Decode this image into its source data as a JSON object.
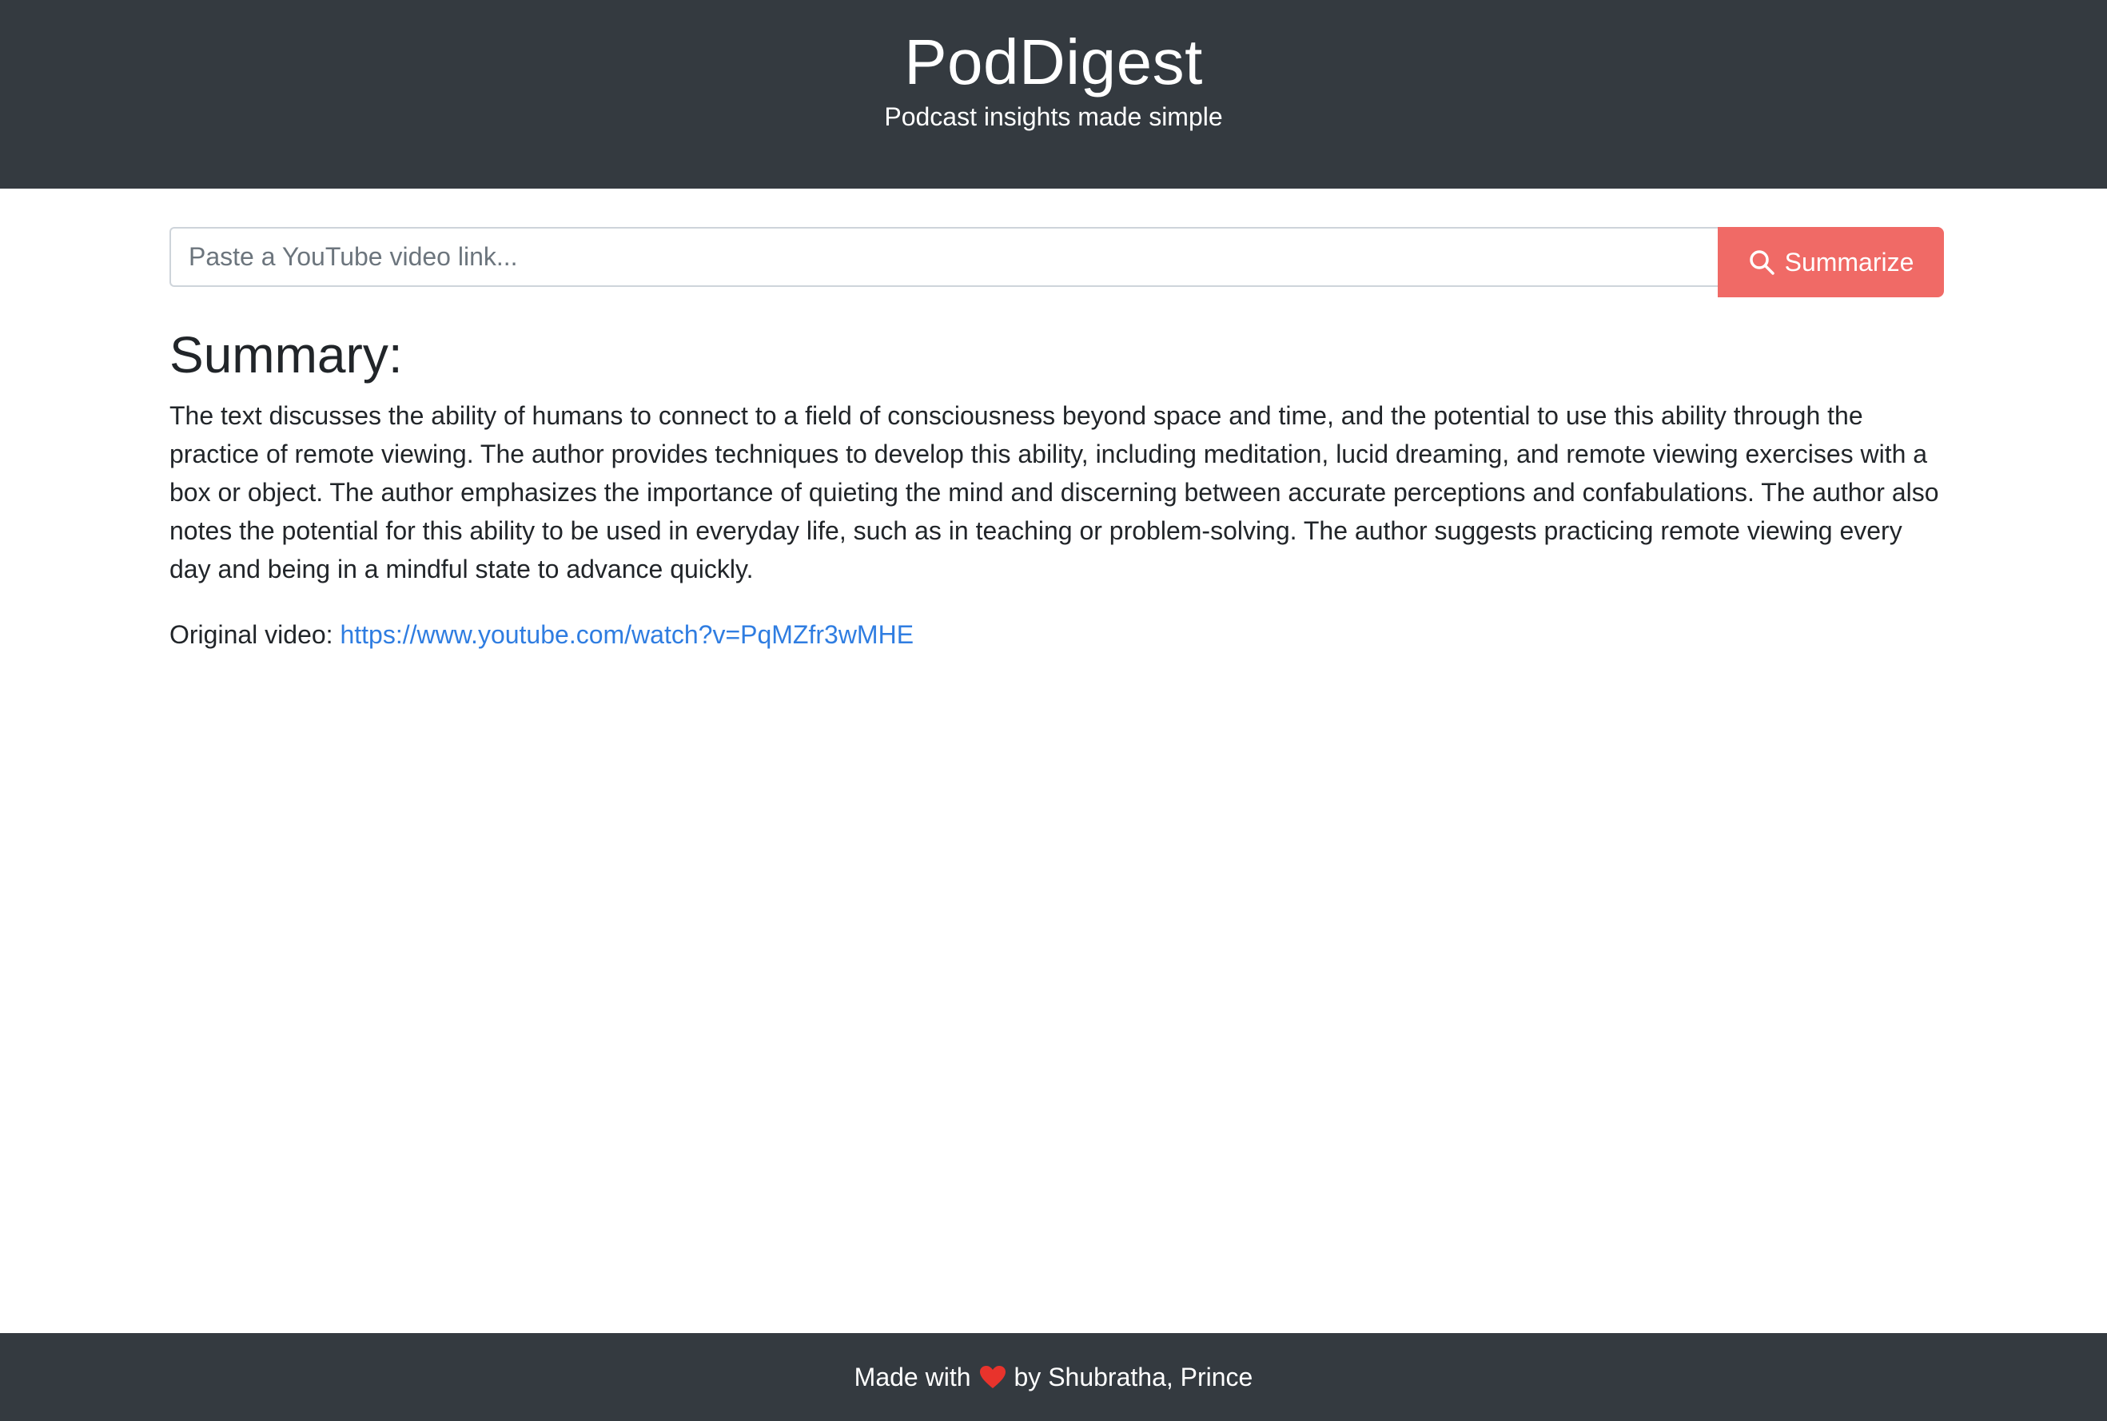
{
  "header": {
    "title": "PodDigest",
    "subtitle": "Podcast insights made simple"
  },
  "search": {
    "placeholder": "Paste a YouTube video link...",
    "value": "",
    "button_label": "Summarize",
    "button_icon": "search-icon",
    "button_color": "#f06a66"
  },
  "summary": {
    "heading": "Summary:",
    "text": "The text discusses the ability of humans to connect to a field of consciousness beyond space and time, and the potential to use this ability through the practice of remote viewing. The author provides techniques to develop this ability, including meditation, lucid dreaming, and remote viewing exercises with a box or object. The author emphasizes the importance of quieting the mind and discerning between accurate perceptions and confabulations. The author also notes the potential for this ability to be used in everyday life, such as in teaching or problem-solving. The author suggests practicing remote viewing every day and being in a mindful state to advance quickly.",
    "original_label": "Original video:",
    "original_url": "https://www.youtube.com/watch?v=PqMZfr3wMHE",
    "link_color": "#2f7de1"
  },
  "footer": {
    "made_with": "Made with",
    "heart_icon": "heart-icon",
    "heart_color": "#e8332c",
    "by_text": "by Shubratha, Prince"
  },
  "colors": {
    "bar_background": "#343a40"
  }
}
